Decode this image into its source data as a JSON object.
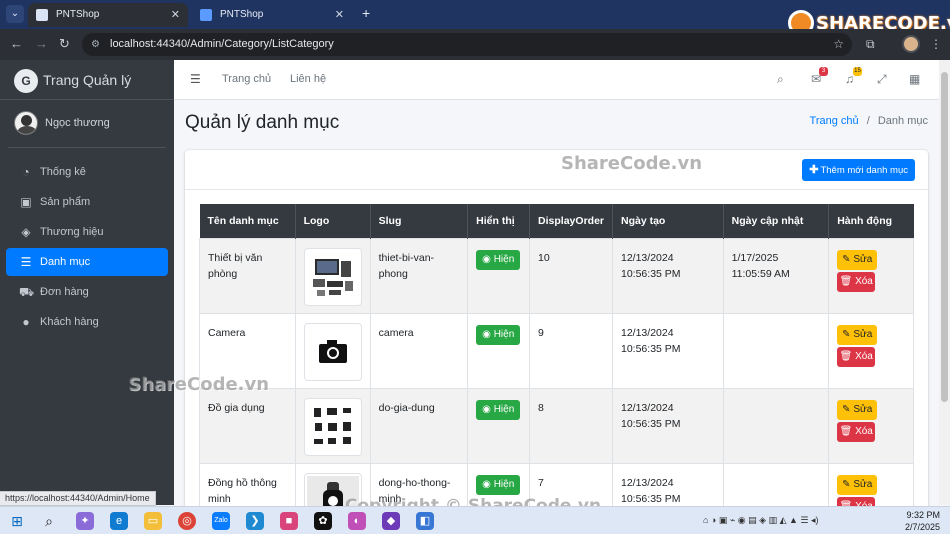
{
  "browser": {
    "tabs": [
      {
        "title": "PNTShop",
        "active": true
      },
      {
        "title": "PNTShop",
        "active": false
      }
    ],
    "url": "localhost:44340/Admin/Category/ListCategory",
    "status_url": "https://localhost:44340/Admin/Home"
  },
  "sidebar": {
    "brand": "Trang Quản lý",
    "user": "Ngọc thương",
    "items": [
      {
        "label": "Thống kê",
        "icon": "dashboard-icon"
      },
      {
        "label": "Sản phẩm",
        "icon": "box-icon"
      },
      {
        "label": "Thương hiệu",
        "icon": "tags-icon"
      },
      {
        "label": "Danh mục",
        "icon": "list-icon",
        "active": true
      },
      {
        "label": "Đơn hàng",
        "icon": "cart-icon"
      },
      {
        "label": "Khách hàng",
        "icon": "user-icon"
      }
    ]
  },
  "navbar": {
    "links": [
      "Trang chủ",
      "Liên hệ"
    ],
    "messages_badge": "3",
    "notifications_badge": "15"
  },
  "page": {
    "title": "Quản lý danh mục",
    "breadcrumb_home": "Trang chủ",
    "breadcrumb_current": "Danh mục",
    "add_button": "Thêm mới danh mục"
  },
  "table": {
    "headers": [
      "Tên danh mục",
      "Logo",
      "Slug",
      "Hiển thị",
      "DisplayOrder",
      "Ngày tạo",
      "Ngày cập nhật",
      "Hành động"
    ],
    "show_label": "Hiện",
    "edit_label": "Sửa",
    "delete_label": "Xóa",
    "rows": [
      {
        "name": "Thiết bị văn phòng",
        "logo": "office-devices-image",
        "slug": "thiet-bi-van-phong",
        "order": "10",
        "created": "12/13/2024 10:56:35 PM",
        "updated": "1/17/2025 11:05:59 AM"
      },
      {
        "name": "Camera",
        "logo": "camera-image",
        "slug": "camera",
        "order": "9",
        "created": "12/13/2024 10:56:35 PM",
        "updated": ""
      },
      {
        "name": "Đồ gia dụng",
        "logo": "appliances-image",
        "slug": "do-gia-dung",
        "order": "8",
        "created": "12/13/2024 10:56:35 PM",
        "updated": ""
      },
      {
        "name": "Đồng hồ thông minh",
        "logo": "smartwatch-image",
        "slug": "dong-ho-thong-minh",
        "order": "7",
        "created": "12/13/2024 10:56:35 PM",
        "updated": ""
      }
    ]
  },
  "watermarks": {
    "brand_logo": "SHARECODE.vn",
    "center": "ShareCode.vn",
    "left": "ShareCode.vn",
    "bottom": "Copyright © ShareCode.vn"
  },
  "taskbar": {
    "time": "9:32 PM",
    "date": "2/7/2025"
  }
}
